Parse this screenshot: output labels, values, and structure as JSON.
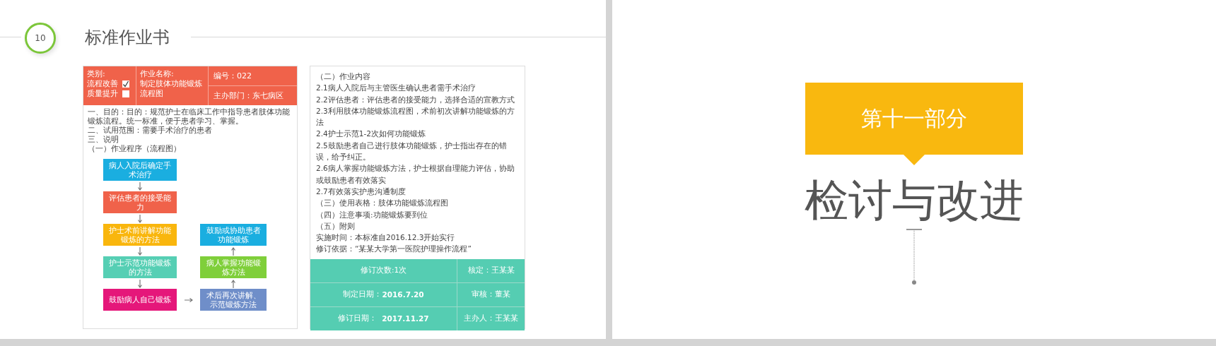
{
  "left_slide": {
    "page_number": "10",
    "title": "标准作业书",
    "header_table": {
      "category_label": "类别:",
      "categories": [
        {
          "label": "流程改善",
          "checked": true
        },
        {
          "label": "质量提升",
          "checked": false
        }
      ],
      "name_label": "作业名称:",
      "name_value": "制定肢体功能锻炼流程图",
      "number": "编号：022",
      "department": "主办部门：东七病区"
    },
    "intro": [
      "一、目的：目的：规范护士在临床工作中指导患者肢体功能锻炼流程。统一标准，便于患者学习、掌握。",
      "二、试用范围：需要手术治疗的患者",
      "三、说明",
      "（一）作业程序（流程图）"
    ],
    "flowchart": {
      "main_steps": [
        {
          "text": "病人入院后确定手术治疗",
          "color": "#1aaee0"
        },
        {
          "text": "评估患者的接受能力",
          "color": "#f0624a"
        },
        {
          "text": "护士术前讲解功能锻炼的方法",
          "color": "#f9b60d"
        },
        {
          "text": "护士示范功能锻炼的方法",
          "color": "#56cfb4"
        },
        {
          "text": "鼓励病人自己锻炼",
          "color": "#e5177a"
        }
      ],
      "follow_up_steps": [
        {
          "text": "鼓励或协助患者功能锻炼",
          "color": "#1aaee0"
        },
        {
          "text": "病人掌握功能锻炼方法",
          "color": "#7fcf3a"
        },
        {
          "text": "术后再次讲解、示范锻炼方法",
          "color": "#6f8ec9"
        }
      ]
    },
    "content_lines": [
      "（二）作业内容",
      "2.1病人入院后与主管医生确认患者需手术治疗",
      "2.2评估患者：评估患者的接受能力，选择合适的宣教方式",
      "2.3利用肢体功能锻炼流程图，术前初次讲解功能锻炼的方法",
      "2.4护士示范1-2次如何功能锻炼",
      "2.5鼓励患者自己进行肢体功能锻炼，护士指出存在的错误，给予纠正。",
      "2.6病人掌握功能锻炼方法，护士根据自理能力评估，协助或鼓励患者有效落实",
      "2.7有效落实护患沟通制度",
      "（三）使用表格：肢体功能锻炼流程图",
      "（四）注意事项:功能锻炼要到位",
      "（五）附则",
      "实施时间：本标准自2016.12.3开始实行",
      "修订依据：“某某大学第一医院护理操作流程”"
    ],
    "footer_table": [
      [
        "修订次数:1次",
        "核定：王某某"
      ],
      [
        "制定日期：**2016.7.20**",
        "审核：董某"
      ],
      [
        "修订日期：  **2017.11.27**",
        "主办人：王某某"
      ]
    ]
  },
  "right_slide": {
    "section_label": "第十一部分",
    "title": "检讨与改进"
  }
}
